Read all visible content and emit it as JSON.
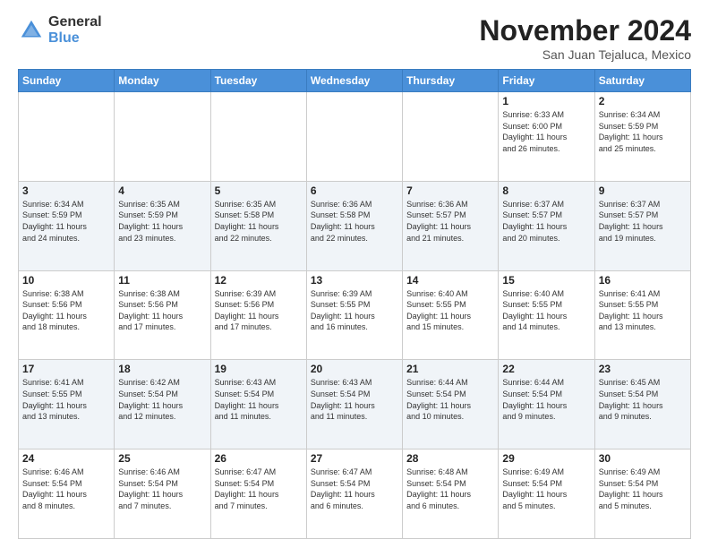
{
  "header": {
    "logo_general": "General",
    "logo_blue": "Blue",
    "month_title": "November 2024",
    "location": "San Juan Tejaluca, Mexico"
  },
  "days_of_week": [
    "Sunday",
    "Monday",
    "Tuesday",
    "Wednesday",
    "Thursday",
    "Friday",
    "Saturday"
  ],
  "weeks": [
    [
      {
        "day": "",
        "info": ""
      },
      {
        "day": "",
        "info": ""
      },
      {
        "day": "",
        "info": ""
      },
      {
        "day": "",
        "info": ""
      },
      {
        "day": "",
        "info": ""
      },
      {
        "day": "1",
        "info": "Sunrise: 6:33 AM\nSunset: 6:00 PM\nDaylight: 11 hours\nand 26 minutes."
      },
      {
        "day": "2",
        "info": "Sunrise: 6:34 AM\nSunset: 5:59 PM\nDaylight: 11 hours\nand 25 minutes."
      }
    ],
    [
      {
        "day": "3",
        "info": "Sunrise: 6:34 AM\nSunset: 5:59 PM\nDaylight: 11 hours\nand 24 minutes."
      },
      {
        "day": "4",
        "info": "Sunrise: 6:35 AM\nSunset: 5:59 PM\nDaylight: 11 hours\nand 23 minutes."
      },
      {
        "day": "5",
        "info": "Sunrise: 6:35 AM\nSunset: 5:58 PM\nDaylight: 11 hours\nand 22 minutes."
      },
      {
        "day": "6",
        "info": "Sunrise: 6:36 AM\nSunset: 5:58 PM\nDaylight: 11 hours\nand 22 minutes."
      },
      {
        "day": "7",
        "info": "Sunrise: 6:36 AM\nSunset: 5:57 PM\nDaylight: 11 hours\nand 21 minutes."
      },
      {
        "day": "8",
        "info": "Sunrise: 6:37 AM\nSunset: 5:57 PM\nDaylight: 11 hours\nand 20 minutes."
      },
      {
        "day": "9",
        "info": "Sunrise: 6:37 AM\nSunset: 5:57 PM\nDaylight: 11 hours\nand 19 minutes."
      }
    ],
    [
      {
        "day": "10",
        "info": "Sunrise: 6:38 AM\nSunset: 5:56 PM\nDaylight: 11 hours\nand 18 minutes."
      },
      {
        "day": "11",
        "info": "Sunrise: 6:38 AM\nSunset: 5:56 PM\nDaylight: 11 hours\nand 17 minutes."
      },
      {
        "day": "12",
        "info": "Sunrise: 6:39 AM\nSunset: 5:56 PM\nDaylight: 11 hours\nand 17 minutes."
      },
      {
        "day": "13",
        "info": "Sunrise: 6:39 AM\nSunset: 5:55 PM\nDaylight: 11 hours\nand 16 minutes."
      },
      {
        "day": "14",
        "info": "Sunrise: 6:40 AM\nSunset: 5:55 PM\nDaylight: 11 hours\nand 15 minutes."
      },
      {
        "day": "15",
        "info": "Sunrise: 6:40 AM\nSunset: 5:55 PM\nDaylight: 11 hours\nand 14 minutes."
      },
      {
        "day": "16",
        "info": "Sunrise: 6:41 AM\nSunset: 5:55 PM\nDaylight: 11 hours\nand 13 minutes."
      }
    ],
    [
      {
        "day": "17",
        "info": "Sunrise: 6:41 AM\nSunset: 5:55 PM\nDaylight: 11 hours\nand 13 minutes."
      },
      {
        "day": "18",
        "info": "Sunrise: 6:42 AM\nSunset: 5:54 PM\nDaylight: 11 hours\nand 12 minutes."
      },
      {
        "day": "19",
        "info": "Sunrise: 6:43 AM\nSunset: 5:54 PM\nDaylight: 11 hours\nand 11 minutes."
      },
      {
        "day": "20",
        "info": "Sunrise: 6:43 AM\nSunset: 5:54 PM\nDaylight: 11 hours\nand 11 minutes."
      },
      {
        "day": "21",
        "info": "Sunrise: 6:44 AM\nSunset: 5:54 PM\nDaylight: 11 hours\nand 10 minutes."
      },
      {
        "day": "22",
        "info": "Sunrise: 6:44 AM\nSunset: 5:54 PM\nDaylight: 11 hours\nand 9 minutes."
      },
      {
        "day": "23",
        "info": "Sunrise: 6:45 AM\nSunset: 5:54 PM\nDaylight: 11 hours\nand 9 minutes."
      }
    ],
    [
      {
        "day": "24",
        "info": "Sunrise: 6:46 AM\nSunset: 5:54 PM\nDaylight: 11 hours\nand 8 minutes."
      },
      {
        "day": "25",
        "info": "Sunrise: 6:46 AM\nSunset: 5:54 PM\nDaylight: 11 hours\nand 7 minutes."
      },
      {
        "day": "26",
        "info": "Sunrise: 6:47 AM\nSunset: 5:54 PM\nDaylight: 11 hours\nand 7 minutes."
      },
      {
        "day": "27",
        "info": "Sunrise: 6:47 AM\nSunset: 5:54 PM\nDaylight: 11 hours\nand 6 minutes."
      },
      {
        "day": "28",
        "info": "Sunrise: 6:48 AM\nSunset: 5:54 PM\nDaylight: 11 hours\nand 6 minutes."
      },
      {
        "day": "29",
        "info": "Sunrise: 6:49 AM\nSunset: 5:54 PM\nDaylight: 11 hours\nand 5 minutes."
      },
      {
        "day": "30",
        "info": "Sunrise: 6:49 AM\nSunset: 5:54 PM\nDaylight: 11 hours\nand 5 minutes."
      }
    ]
  ]
}
